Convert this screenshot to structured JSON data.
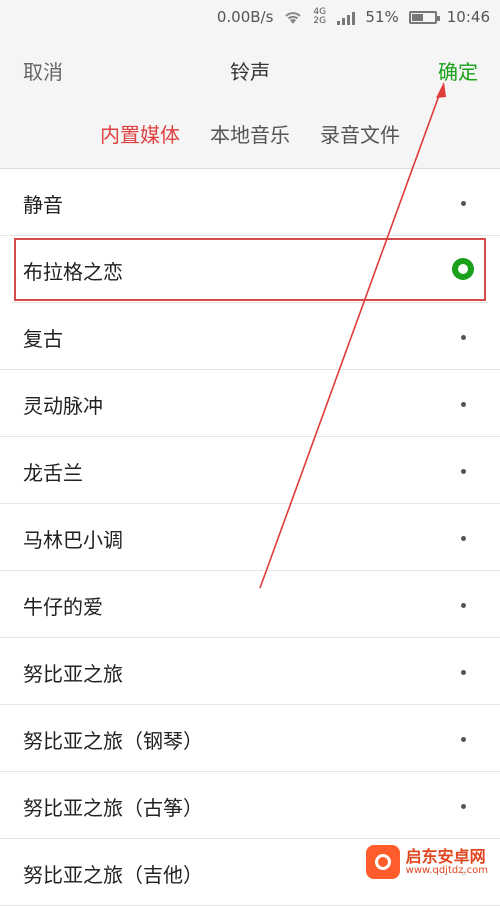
{
  "status_bar": {
    "net_speed": "0.00B/s",
    "network": "4G 2G",
    "battery": "51%",
    "battery_level": 0.51,
    "time": "10:46"
  },
  "header": {
    "cancel": "取消",
    "title": "铃声",
    "confirm": "确定"
  },
  "tabs": [
    {
      "label": "内置媒体",
      "active": true
    },
    {
      "label": "本地音乐",
      "active": false
    },
    {
      "label": "录音文件",
      "active": false
    }
  ],
  "ringtones": [
    {
      "label": "静音",
      "selected": false
    },
    {
      "label": "布拉格之恋",
      "selected": true
    },
    {
      "label": "复古",
      "selected": false
    },
    {
      "label": "灵动脉冲",
      "selected": false
    },
    {
      "label": "龙舌兰",
      "selected": false
    },
    {
      "label": "马林巴小调",
      "selected": false
    },
    {
      "label": "牛仔的爱",
      "selected": false
    },
    {
      "label": "努比亚之旅",
      "selected": false
    },
    {
      "label": "努比亚之旅（钢琴）",
      "selected": false
    },
    {
      "label": "努比亚之旅（古筝）",
      "selected": false
    },
    {
      "label": "努比亚之旅（吉他）",
      "selected": false
    }
  ],
  "watermark": {
    "name": "启东安卓网",
    "url": "www.qdjtdz.com"
  },
  "colors": {
    "accent_green": "#1aa01a",
    "tab_active_red": "#e04141",
    "highlight_box": "#d84a4a",
    "annotation_arrow": "#e03a3a"
  }
}
